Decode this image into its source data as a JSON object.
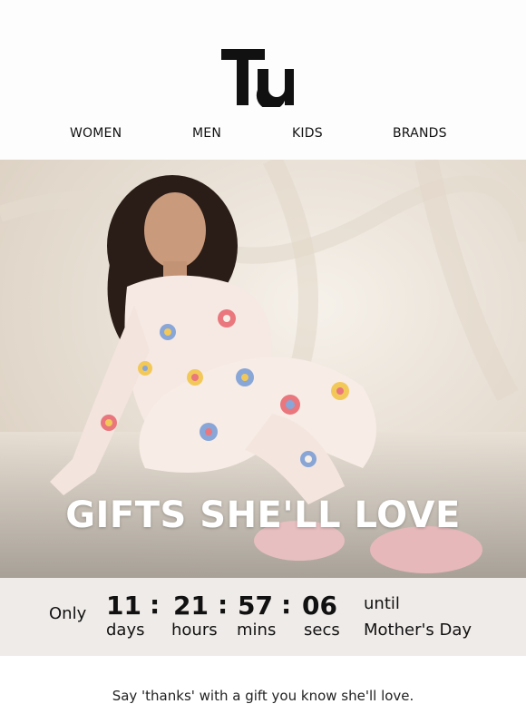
{
  "brand": {
    "logo_text": "Tu"
  },
  "nav": {
    "items": [
      "WOMEN",
      "MEN",
      "KIDS",
      "BRANDS"
    ]
  },
  "hero": {
    "title": "GIFTS SHE'LL LOVE"
  },
  "countdown": {
    "prefix": "Only",
    "days": "11",
    "days_label": "days",
    "hours": "21",
    "hours_label": "hours",
    "mins": "57",
    "mins_label": "mins",
    "secs": "06",
    "secs_label": "secs",
    "suffix_top": "until",
    "suffix_bottom": "Mother's Day"
  },
  "body": {
    "intro": "Say 'thanks' with a gift you know she'll love."
  }
}
